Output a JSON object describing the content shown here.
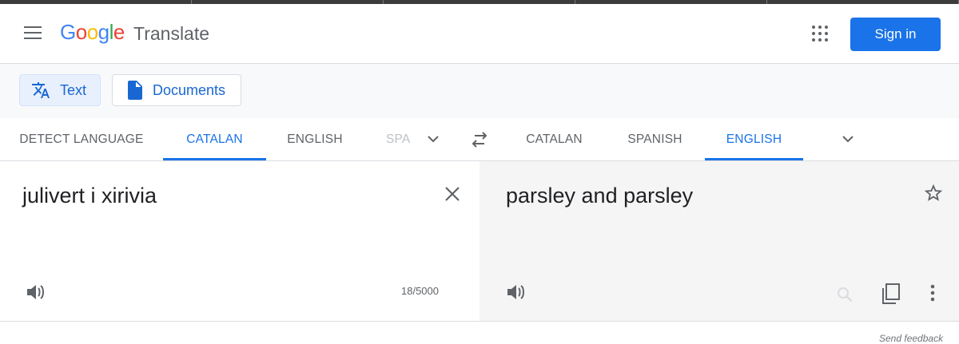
{
  "header": {
    "logo_letters": [
      "G",
      "o",
      "o",
      "g",
      "l",
      "e"
    ],
    "product": "Translate",
    "signin": "Sign in",
    "icons": {
      "menu": "hamburger-menu-icon",
      "apps": "apps-grid-icon"
    }
  },
  "modes": {
    "text": "Text",
    "documents": "Documents",
    "icons": {
      "text": "translate-icon",
      "documents": "document-icon"
    }
  },
  "source_langs": {
    "detect": "DETECT LANGUAGE",
    "catalan": "CATALAN",
    "english": "ENGLISH",
    "spanish_partial": "SPA"
  },
  "target_langs": {
    "catalan": "CATALAN",
    "spanish": "SPANISH",
    "english": "ENGLISH"
  },
  "source": {
    "text": "julivert i xirivia",
    "count": "18/5000"
  },
  "target": {
    "text": "parsley and parsley"
  },
  "footer": {
    "feedback": "Send feedback"
  },
  "colors": {
    "accent": "#1a73e8",
    "target_bg": "#f5f5f5"
  }
}
